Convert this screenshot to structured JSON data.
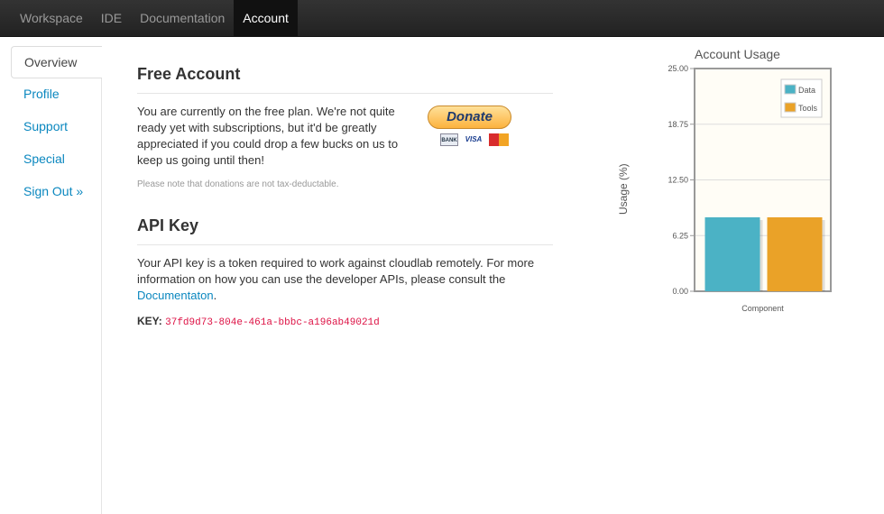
{
  "nav": {
    "items": [
      {
        "label": "Workspace",
        "active": false
      },
      {
        "label": "IDE",
        "active": false
      },
      {
        "label": "Documentation",
        "active": false
      },
      {
        "label": "Account",
        "active": true
      }
    ]
  },
  "sidebar": {
    "items": [
      {
        "label": "Overview",
        "active": true
      },
      {
        "label": "Profile",
        "active": false
      },
      {
        "label": "Support",
        "active": false
      },
      {
        "label": "Special",
        "active": false
      },
      {
        "label": "Sign Out »",
        "active": false
      }
    ]
  },
  "free_account": {
    "title": "Free Account",
    "text": "You are currently on the free plan. We're not quite ready yet with subscriptions, but it'd be greatly appreciated if you could drop a few bucks on us to keep us going until then!",
    "donate_label": "Donate",
    "cards": [
      "BANK",
      "VISA",
      "MasterCard"
    ],
    "note": "Please note that donations are not tax-deductable."
  },
  "api": {
    "title": "API Key",
    "text": "Your API key is a token required to work against cloudlab remotely. For more information on how you can use the developer APIs, please consult the",
    "link": "Documentaton",
    "link_suffix": ".",
    "key_label": "KEY:",
    "key_value": "37fd9d73-804e-461a-bbbc-a196ab49021d"
  },
  "chart_data": {
    "type": "bar",
    "title": "Account Usage",
    "xlabel": "Component",
    "ylabel": "Usage (%)",
    "ylim": [
      0,
      25
    ],
    "ytick_labels": [
      "0.00",
      "6.25",
      "12.50",
      "18.75",
      "25.00"
    ],
    "categories": [
      "Component"
    ],
    "series": [
      {
        "name": "Data",
        "values": [
          8.3
        ],
        "color": "#4bb2c5"
      },
      {
        "name": "Tools",
        "values": [
          8.3
        ],
        "color": "#eaa228"
      }
    ],
    "grid": true,
    "legend": "top-right",
    "background": "#fffdf6"
  }
}
